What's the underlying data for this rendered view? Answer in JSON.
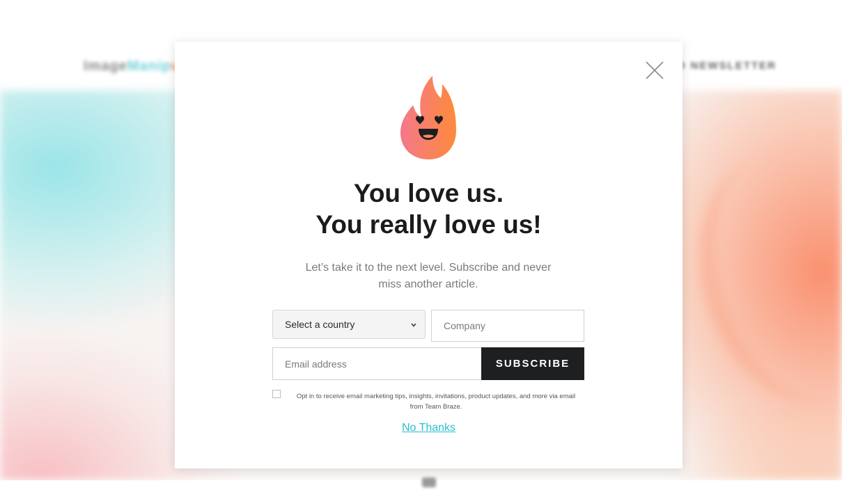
{
  "background": {
    "logo_a": "Image",
    "logo_b": "Manip",
    "logo_c": "ulati",
    "nav_link": "SUBSCRIBE TO NEWSLETTER"
  },
  "popup": {
    "headline_line1": "You love us.",
    "headline_line2": "You really love us!",
    "subtitle": "Let’s take it to the next level. Subscribe and never miss another article.",
    "country_select": {
      "selected": "Select a country",
      "options": [
        "Select a country"
      ]
    },
    "company_placeholder": "Company",
    "email_placeholder": "Email address",
    "subscribe_label": "SUBSCRIBE",
    "optin_text": "Opt in to receive email marketing tips, insights, invitations, product updates, and more via email from Team Braze.",
    "optin_checked": false,
    "no_thanks_label": "No Thanks"
  },
  "colors": {
    "flame_top": "#fa8c55",
    "flame_bottom": "#f46a8a",
    "button_bg": "#1e1f21",
    "link": "#2bbfce",
    "headline": "#1b1b1b"
  },
  "icons": {
    "close": "close-icon",
    "flame": "flame-mascot-icon",
    "chevron": "chevron-down-icon"
  }
}
